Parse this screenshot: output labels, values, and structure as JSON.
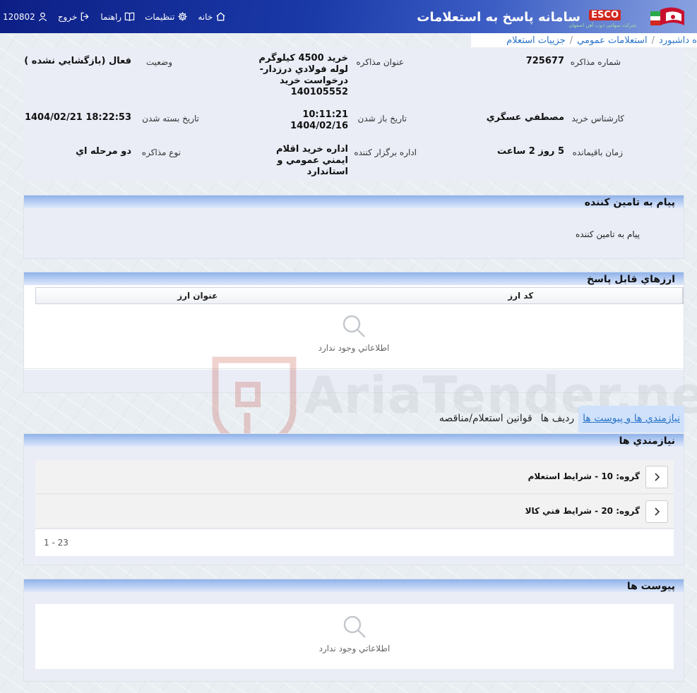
{
  "header": {
    "app_title": "سامانه پاسخ به استعلامات",
    "brand": "ESCO",
    "brand_sub": "شرکت سهامی ذوب آهن اصفهان",
    "nav": [
      {
        "label": "خانه",
        "icon": "home-icon"
      },
      {
        "label": "تنظیمات",
        "icon": "gear-icon"
      },
      {
        "label": "راهنما",
        "icon": "book-icon"
      },
      {
        "label": "خروج",
        "icon": "logout-icon"
      }
    ],
    "user_code": "120802",
    "user_icon": "user-icon"
  },
  "breadcrumb": [
    "ه داشبورد",
    "استعلامات عمومي",
    "جزييات استعلام"
  ],
  "info": {
    "fields": [
      {
        "label": "شماره مذاكره",
        "value": "725677"
      },
      {
        "label": "عنوان مذاكره",
        "value": "خريد 4500 كيلوگرم لوله فولادي درزدار- درخواست خريد 140105552"
      },
      {
        "label": "وضعيت",
        "value": "فعال (بازگشايي نشده )"
      },
      {
        "label": "كارشناس خريد",
        "value": "مصطفي عسگري"
      },
      {
        "label": "تاريخ باز شدن",
        "value": "10:11:21 1404/02/16"
      },
      {
        "label": "تاريخ بسته شدن",
        "value": "1404/02/21 18:22:53"
      },
      {
        "label": "زمان باقيمانده",
        "value": "5 روز 2 ساعت"
      },
      {
        "label": "اداره برگزار كننده",
        "value": "اداره خريد اقلام ايمني عمومي و استاندارد"
      },
      {
        "label": "نوع مذاكره",
        "value": "دو مرحله اي"
      }
    ]
  },
  "supplier_message": {
    "title": "پيام به تامين كننده",
    "text": "پيام به تامين كننده"
  },
  "currencies": {
    "title": "ارزهاي قابل پاسخ",
    "columns": [
      "كد ارز",
      "عنوان ارز"
    ],
    "empty_text": "اطلاعاتي وجود ندارد"
  },
  "tabs": [
    {
      "label": "نيازمندي ها و پيوست ها",
      "active": true
    },
    {
      "label": "رديف ها",
      "active": false
    },
    {
      "label": "قوانين استعلام/مناقصه",
      "active": false
    }
  ],
  "requirements": {
    "title": "نيازمندي ها",
    "groups": [
      {
        "label": "گروه: 10 - شرايط استعلام"
      },
      {
        "label": "گروه: 20 - شرايط فني كالا"
      }
    ],
    "pager": "1 - 23"
  },
  "attachments": {
    "title": "پيوست ها",
    "empty_text": "اطلاعاتي وجود ندارد"
  },
  "watermark": "AriaTender.neT",
  "colors": {
    "header_dark": "#0d1f86",
    "accent_blue": "#2a74c8",
    "panel_bg": "#eaedf6",
    "brand_red": "#d1271f"
  }
}
